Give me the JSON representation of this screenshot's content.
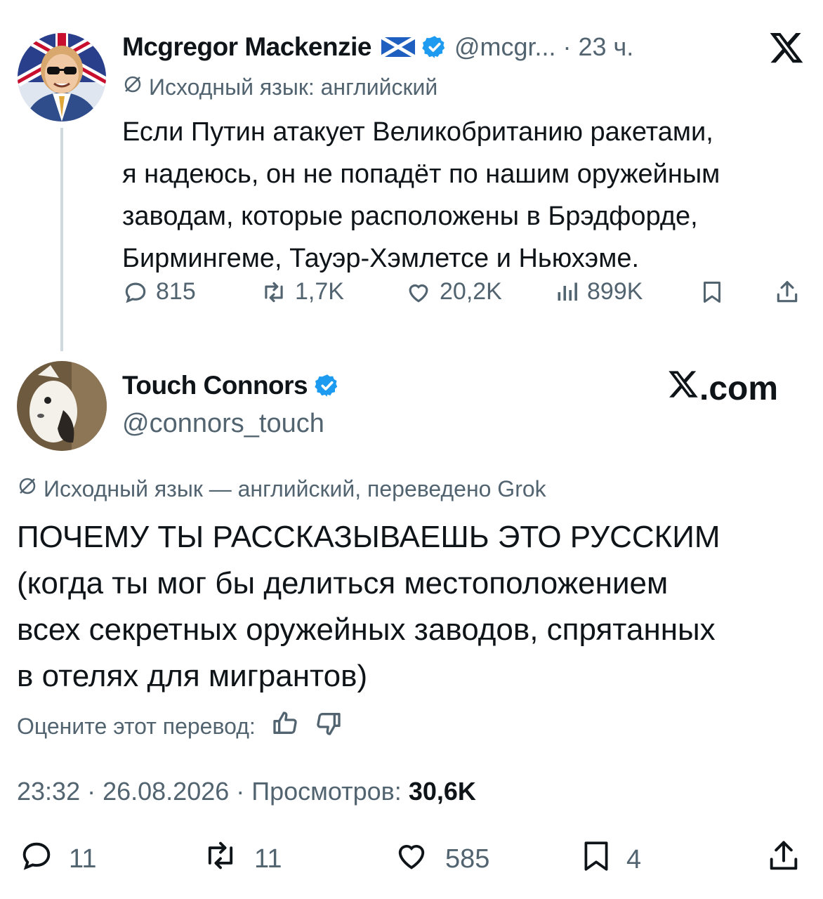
{
  "tweet1": {
    "author_name": "Mcgregor Mackenzie",
    "handle": "@mcgr...",
    "time": "· 23 ч.",
    "source_lang": "Исходный язык: английский",
    "body_lines": [
      "Если Путин атакует Великобританию ракетами,",
      "я надеюсь, он не попадёт по нашим оружейным",
      "заводам, которые расположены в Брэдфорде,",
      "Бирмингеме, Тауэр-Хэмлетсе и Ньюхэме."
    ],
    "stats": {
      "replies": "815",
      "reposts": "1,7K",
      "likes": "20,2K",
      "views": "899K"
    }
  },
  "tweet2": {
    "author_name": "Touch Connors",
    "handle": "@connors_touch",
    "site": ".com",
    "source_lang": "Исходный язык — английский, переведено Grok",
    "body_lines": [
      "ПОЧЕМУ ТЫ РАССКАЗЫВАЕШЬ ЭТО РУССКИМ",
      "(когда ты мог бы делиться местоположением",
      "всех секретных оружейных заводов, спрятанных",
      "в отелях для мигрантов)"
    ],
    "rate_label": "Оцените этот перевод:",
    "meta_prefix": "23:32 · 26.08.2026 · Просмотров: ",
    "views": "30,6K",
    "stats": {
      "replies": "11",
      "reposts": "11",
      "likes": "585",
      "bookmarks": "4"
    }
  },
  "icons": {
    "globe": "globe-icon",
    "verified": "verified-badge-icon",
    "flag": "scotland-flag-icon",
    "reply": "reply-icon",
    "repost": "repost-icon",
    "like": "like-icon",
    "views": "views-icon",
    "bookmark": "bookmark-icon",
    "share": "share-icon",
    "x_logo": "x-logo-icon",
    "thumbs_up": "thumbs-up-icon",
    "thumbs_down": "thumbs-down-icon"
  },
  "colors": {
    "verified": "#1d9bf0",
    "text": "#0f1419",
    "secondary": "#536471",
    "line": "#cfd9de"
  }
}
